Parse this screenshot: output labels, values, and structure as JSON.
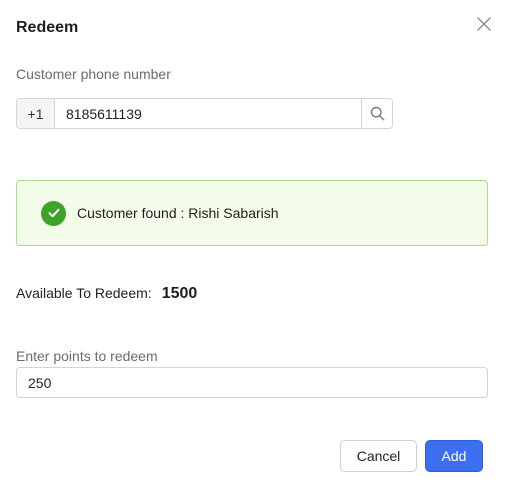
{
  "dialog": {
    "title": "Redeem",
    "close_icon": "close-icon"
  },
  "phone": {
    "label": "Customer phone number",
    "country_code": "+1",
    "value": "8185611139",
    "search_icon": "search-icon"
  },
  "alert": {
    "icon": "check-circle-icon",
    "message": "Customer found : Rishi Sabarish",
    "success_color": "#3fa32b",
    "background": "#f3fbe9",
    "border": "#a9dc8a"
  },
  "available": {
    "label": "Available To Redeem:",
    "value": "1500"
  },
  "points": {
    "label": "Enter points to redeem",
    "value": "250"
  },
  "actions": {
    "cancel_label": "Cancel",
    "add_label": "Add",
    "accent_color": "#3b6ff0"
  }
}
